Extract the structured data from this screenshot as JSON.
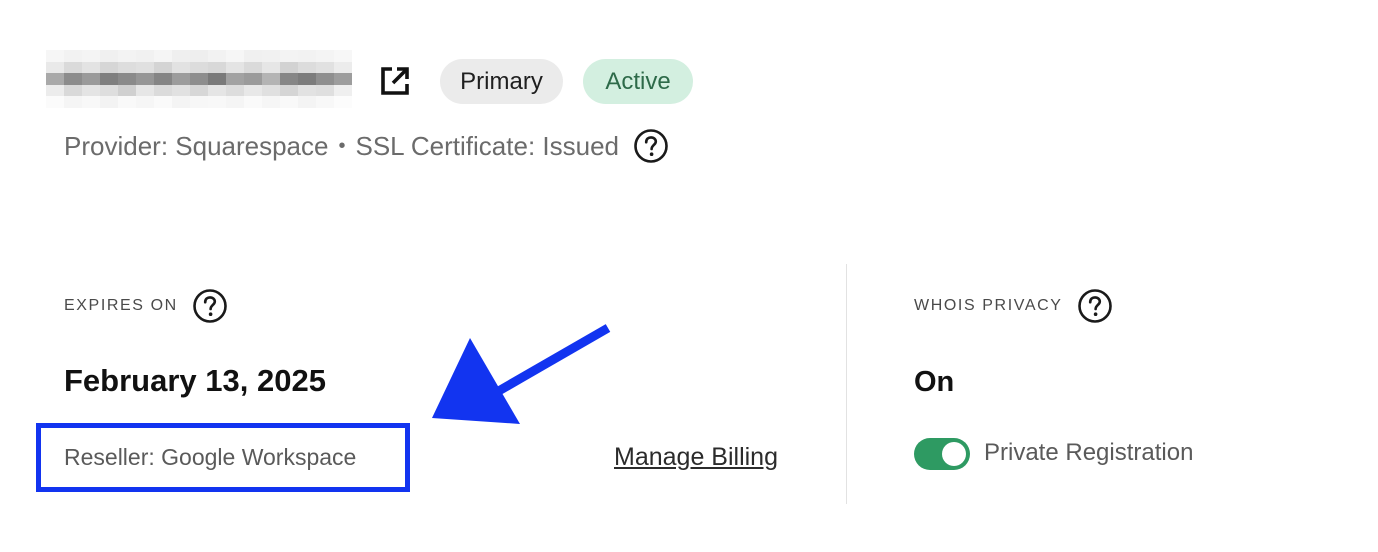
{
  "domain": {
    "badges": {
      "primary": "Primary",
      "active": "Active"
    },
    "provider": "Provider: Squarespace",
    "separator": "•",
    "ssl": "SSL Certificate: Issued",
    "icons": {
      "external_link": "external-link-icon",
      "help": "question-circle-icon"
    }
  },
  "expiry": {
    "label": "EXPIRES ON",
    "date": "February 13, 2025",
    "reseller": "Reseller: Google Workspace",
    "manage_billing": "Manage Billing"
  },
  "whois": {
    "label": "WHOIS PRIVACY",
    "value": "On",
    "toggle_on": true,
    "toggle_label": "Private Registration"
  },
  "colors": {
    "active_badge_bg": "#d3efe0",
    "active_badge_text": "#2d6a49",
    "primary_badge_bg": "#ebebeb",
    "toggle_on": "#2e9a62",
    "annotation_blue": "#1234f0"
  }
}
